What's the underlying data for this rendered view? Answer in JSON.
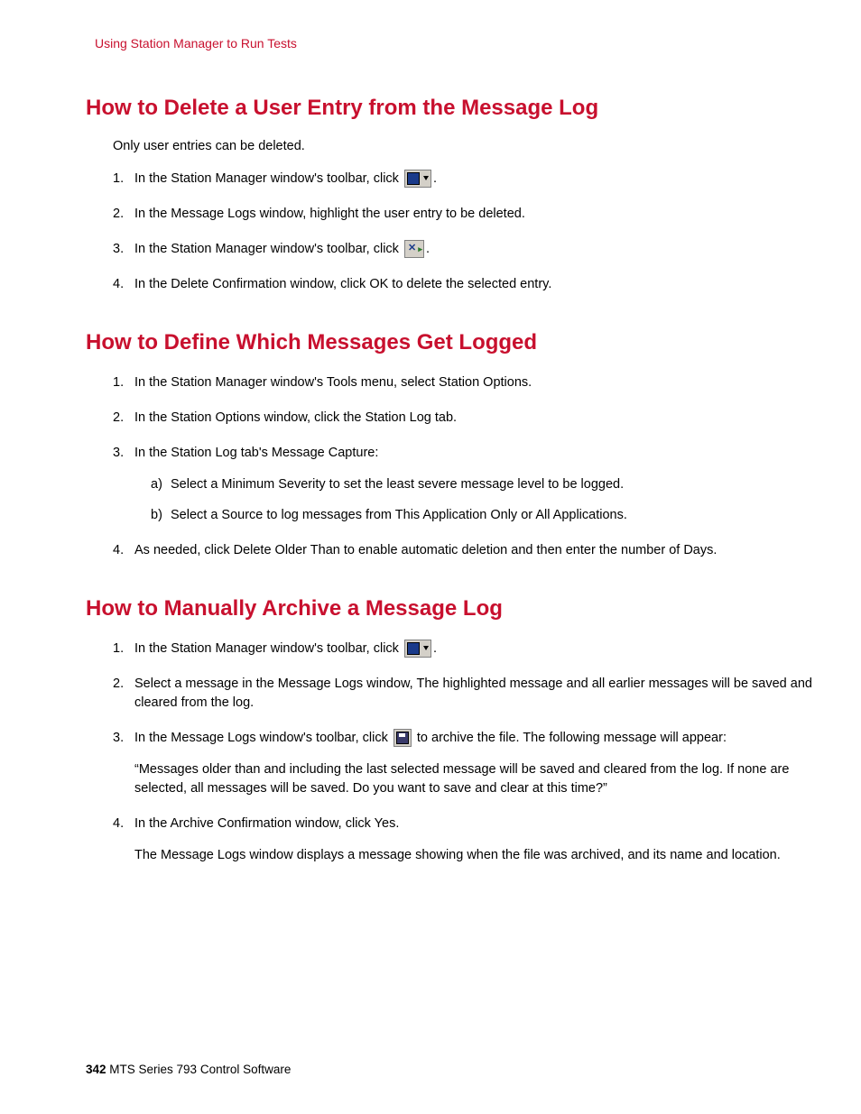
{
  "header": {
    "breadcrumb": "Using Station Manager to Run Tests"
  },
  "sections": {
    "delete": {
      "title": "How to Delete a User Entry from the Message Log",
      "intro": "Only user entries can be deleted.",
      "steps": {
        "s1a": "In the Station Manager window's toolbar, click ",
        "s1b": ".",
        "s2": "In the Message Logs window, highlight the user entry to be deleted.",
        "s3a": "In the Station Manager window's toolbar, click ",
        "s3b": ".",
        "s4": "In the Delete Confirmation window, click OK to delete the selected entry."
      }
    },
    "define": {
      "title": "How to Define Which Messages Get Logged",
      "steps": {
        "s1": "In the Station Manager window's Tools menu, select Station Options.",
        "s2": "In the Station Options window, click the Station Log tab.",
        "s3": "In the Station Log tab's Message Capture:",
        "s3a": "Select a Minimum Severity to set the least severe message level to be logged.",
        "s3b": "Select a Source to log messages from This Application Only or All Applications.",
        "s4": "As needed, click Delete Older Than to enable automatic deletion and then enter the number of Days."
      }
    },
    "archive": {
      "title": "How to Manually Archive a Message Log",
      "steps": {
        "s1a": "In the Station Manager window's toolbar, click ",
        "s1b": ".",
        "s2": "Select a message in the Message Logs window, The highlighted message and all earlier messages will be saved and cleared from the log.",
        "s3a": "In the Message Logs window's toolbar, click ",
        "s3b": " to archive the file. The following message will appear:",
        "s3note": "“Messages older than and including the last selected message will be saved and cleared from the log. If none are selected, all messages will be saved. Do you want to save and clear at this time?”",
        "s4": "In the Archive Confirmation window, click Yes.",
        "s4note": "The Message Logs window displays a message showing when the file was archived, and its name and location."
      }
    }
  },
  "footer": {
    "page_number": "342",
    "doc_title": " MTS Series 793 Control Software"
  }
}
